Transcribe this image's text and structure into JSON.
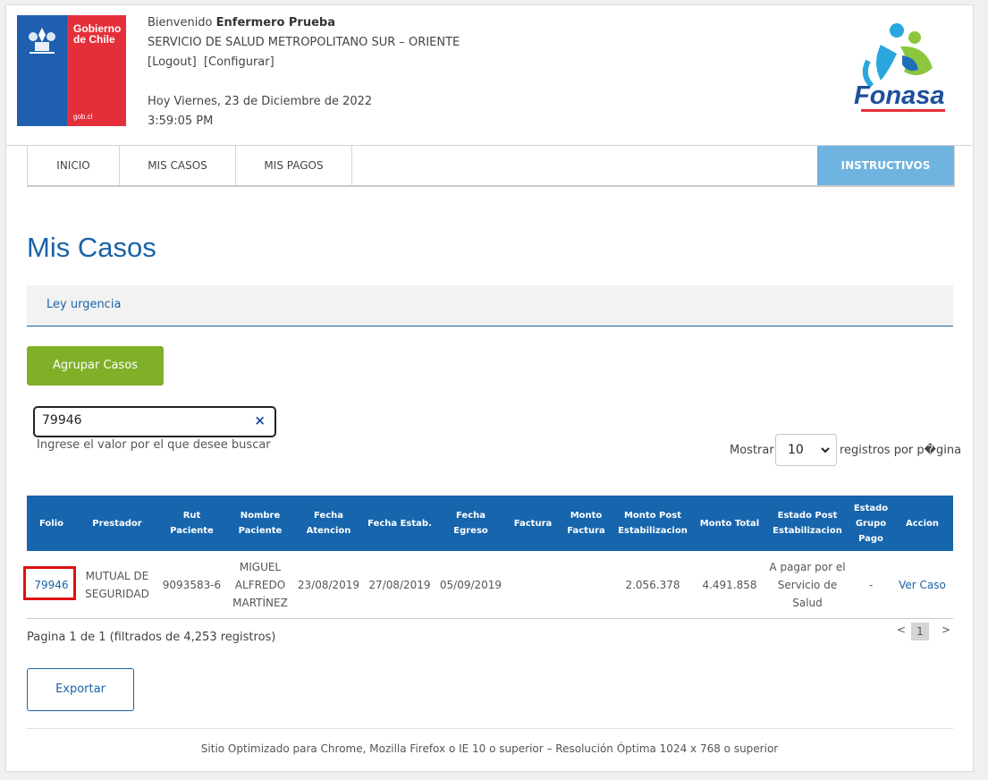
{
  "header": {
    "gob_logo": {
      "line1": "Gobierno",
      "line2": "de Chile",
      "domain": "gob.cl"
    },
    "welcome_prefix": "Bienvenido",
    "user_name": "Enfermero Prueba",
    "service": "SERVICIO DE SALUD METROPOLITANO SUR – ORIENTE",
    "logout": "[Logout]",
    "configurar": "[Configurar]",
    "date": "Hoy Viernes, 23 de Diciembre de 2022",
    "time": "3:59:05 PM",
    "fonasa_logo": "Fonasa"
  },
  "nav": {
    "items": [
      "INICIO",
      "MIS CASOS",
      "MIS PAGOS"
    ],
    "instructivos": "INSTRUCTIVOS"
  },
  "page_title": "Mis Casos",
  "tab": "Ley urgencia",
  "agrupar_button": "Agrupar Casos",
  "search": {
    "value": "79946",
    "clear_icon": "×",
    "hint": "Ingrese el valor por el que desee buscar"
  },
  "page_size": {
    "label_before": "Mostrar",
    "value": "10",
    "label_after": "registros por p�gina"
  },
  "table": {
    "headers": [
      "Folio",
      "Prestador",
      "Rut\nPaciente",
      "Nombre\nPaciente",
      "Fecha\nAtencion",
      "Fecha Estab.",
      "Fecha\nEgreso",
      "Factura",
      "Monto\nFactura",
      "Monto Post\nEstabilizacion",
      "Monto Total",
      "Estado Post\nEstabilizacion",
      "Estado\nGrupo\nPago",
      "Accion"
    ],
    "rows": [
      {
        "folio": "79946",
        "prestador": "MUTUAL DE\nSEGURIDAD",
        "rut": "9093583-6",
        "nombre": "MIGUEL\nALFREDO\nMARTÍNEZ",
        "fecha_atencion": "23/08/2019",
        "fecha_estab": "27/08/2019",
        "fecha_egreso": "05/09/2019",
        "factura": "",
        "monto_factura": "",
        "monto_post": "2.056.378",
        "monto_total": "4.491.858",
        "estado_post": "A pagar por el\nServicio de\nSalud",
        "estado_grupo": "-",
        "accion": "Ver Caso"
      }
    ]
  },
  "pagination": {
    "summary": "Pagina 1 de 1 (filtrados de 4,253 registros)",
    "prev": "<",
    "current": "1",
    "next": ">"
  },
  "export_button": "Exportar",
  "footer": "Sitio Optimizado para Chrome, Mozilla Firefox o IE 10 o superior – Resolución Óptima 1024 x 768 o superior"
}
